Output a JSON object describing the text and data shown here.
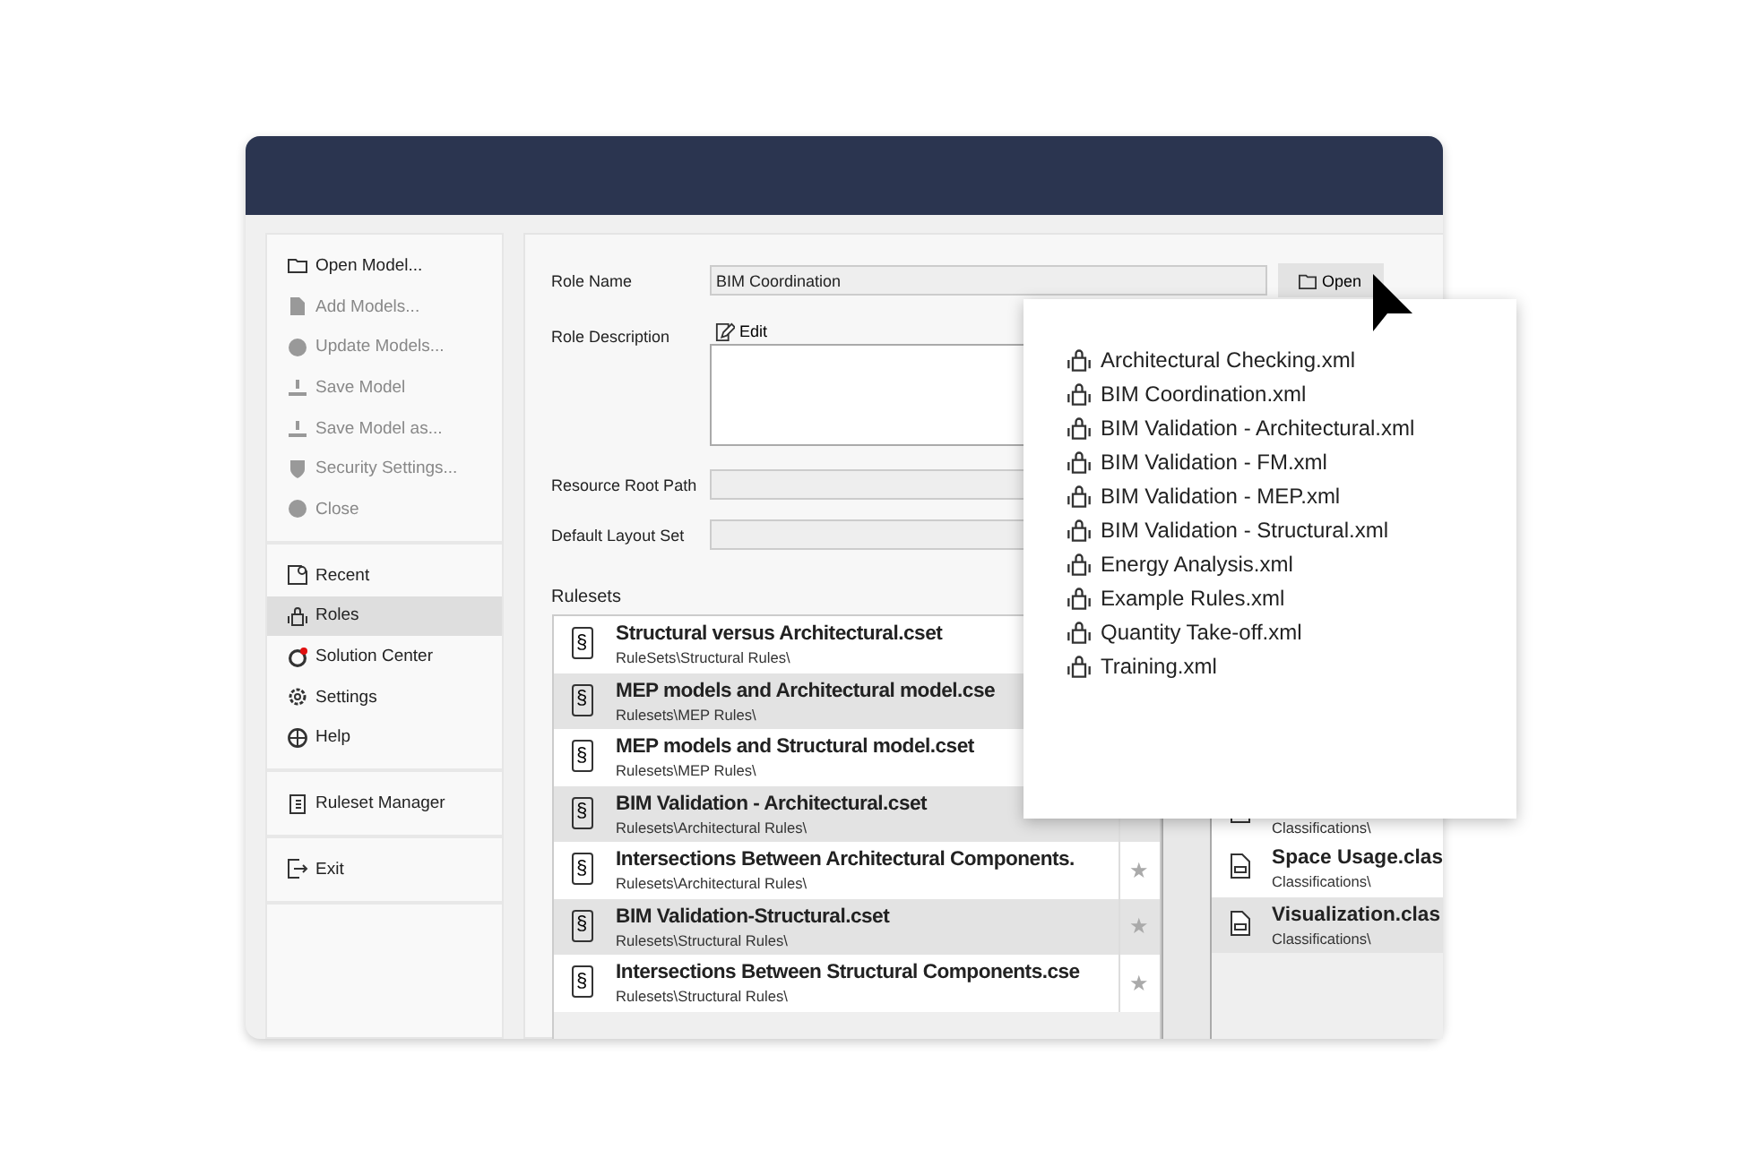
{
  "sidebar": {
    "groups": [
      [
        {
          "label": "Open Model...",
          "disabled": false,
          "selected": false
        },
        {
          "label": "Add Models...",
          "disabled": true,
          "selected": false
        },
        {
          "label": "Update Models...",
          "disabled": true,
          "selected": false
        },
        {
          "label": "Save Model",
          "disabled": true,
          "selected": false
        },
        {
          "label": "Save Model as...",
          "disabled": true,
          "selected": false
        },
        {
          "label": "Security Settings...",
          "disabled": true,
          "selected": false
        },
        {
          "label": "Close",
          "disabled": true,
          "selected": false
        }
      ],
      [
        {
          "label": "Recent",
          "disabled": false,
          "selected": false
        },
        {
          "label": "Roles",
          "disabled": false,
          "selected": true
        },
        {
          "label": "Solution Center",
          "disabled": false,
          "selected": false
        },
        {
          "label": "Settings",
          "disabled": false,
          "selected": false
        },
        {
          "label": "Help",
          "disabled": false,
          "selected": false
        }
      ],
      [
        {
          "label": "Ruleset Manager",
          "disabled": false,
          "selected": false
        }
      ],
      [
        {
          "label": "Exit",
          "disabled": false,
          "selected": false
        }
      ]
    ]
  },
  "form": {
    "role_name_label": "Role Name",
    "role_name_value": "BIM Coordination",
    "open_button": "Open",
    "role_description_label": "Role Description",
    "edit_button": "Edit",
    "resource_root_label": "Resource Root Path",
    "default_layout_label": "Default Layout Set"
  },
  "rulesets": {
    "title": "Rulesets",
    "rows": [
      {
        "icon": "§",
        "name": "Structural versus Architectural.cset",
        "path": "RuleSets\\Structural Rules\\"
      },
      {
        "icon": "§",
        "name": "MEP models and Architectural model.cse",
        "path": "Rulesets\\MEP Rules\\"
      },
      {
        "icon": "§",
        "name": "MEP models and Structural model.cset",
        "path": "Rulesets\\MEP Rules\\"
      },
      {
        "icon": "§",
        "name": "BIM Validation - Architectural.cset",
        "path": "Rulesets\\Architectural Rules\\"
      },
      {
        "icon": "§",
        "name": "Intersections Between Architectural Components.",
        "path": "Rulesets\\Architectural Rules\\",
        "star": "★"
      },
      {
        "icon": "§",
        "name": "BIM Validation-Structural.cset",
        "path": "Rulesets\\Structural Rules\\",
        "star": "★"
      },
      {
        "icon": "§",
        "name": "Intersections Between Structural Components.cse",
        "path": "Rulesets\\Structural Rules\\",
        "star": "★"
      }
    ]
  },
  "classifications": {
    "rows": [
      {
        "path": "Classifications\\",
        "selected": false
      },
      {
        "name": "Space Usage.clas",
        "path": "Classifications\\",
        "selected": false
      },
      {
        "name": "Visualization.clas",
        "path": "Classifications\\",
        "selected": true
      }
    ]
  },
  "roles_popup": {
    "items": [
      "Architectural Checking.xml",
      "BIM Coordination.xml",
      "BIM Validation - Architectural.xml",
      "BIM Validation - FM.xml",
      "BIM Validation - MEP.xml",
      "BIM Validation - Structural.xml",
      "Energy Analysis.xml",
      "Example Rules.xml",
      "Quantity Take-off.xml",
      "Training.xml"
    ]
  }
}
